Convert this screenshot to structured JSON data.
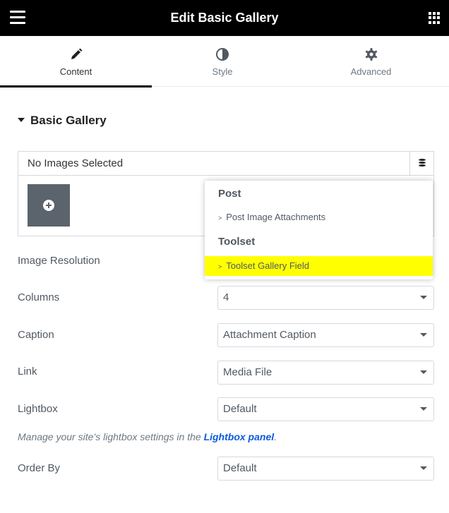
{
  "header": {
    "title": "Edit Basic Gallery"
  },
  "tabs": [
    {
      "label": "Content",
      "icon": "pencil-icon",
      "active": true
    },
    {
      "label": "Style",
      "icon": "half-circle-icon",
      "active": false
    },
    {
      "label": "Advanced",
      "icon": "gear-icon",
      "active": false
    }
  ],
  "section": {
    "title": "Basic Gallery"
  },
  "gallery": {
    "header_text": "No Images Selected",
    "dynamic_icon": "database-icon",
    "add_icon": "plus-circle-icon"
  },
  "controls": {
    "image_resolution": {
      "label": "Image Resolution"
    },
    "columns": {
      "label": "Columns",
      "value": "4"
    },
    "caption": {
      "label": "Caption",
      "value": "Attachment Caption"
    },
    "link": {
      "label": "Link",
      "value": "Media File"
    },
    "lightbox": {
      "label": "Lightbox",
      "value": "Default"
    },
    "order_by": {
      "label": "Order By",
      "value": "Default"
    }
  },
  "note": {
    "text": "Manage your site’s lightbox settings in the",
    "link_text": "Lightbox panel",
    "suffix": "."
  },
  "popover": {
    "groups": [
      {
        "title": "Post",
        "items": [
          "Post Image Attachments"
        ]
      },
      {
        "title": "Toolset",
        "items": [
          "Toolset Gallery Field"
        ]
      }
    ],
    "bullet": ">",
    "highlight_color": "#ffff00"
  },
  "colors": {
    "header_bg": "#000000",
    "link": "#0c5adb",
    "tile_bg": "#5b636c"
  }
}
